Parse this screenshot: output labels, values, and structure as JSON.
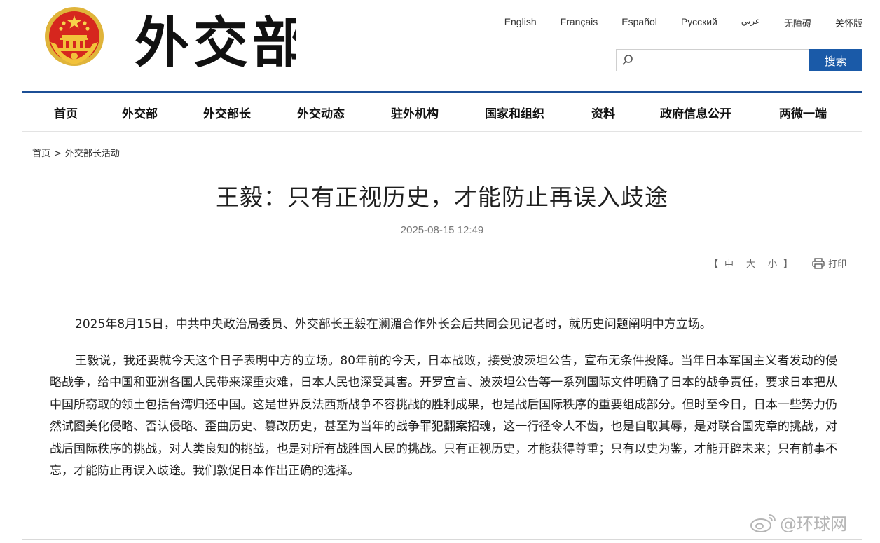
{
  "header": {
    "site_name": "外交部",
    "languages": [
      "English",
      "Français",
      "Español",
      "Русский",
      "عربي",
      "无障碍",
      "关怀版"
    ],
    "search": {
      "placeholder": "",
      "button_label": "搜索"
    }
  },
  "nav": {
    "items": [
      "首页",
      "外交部",
      "外交部长",
      "外交动态",
      "驻外机构",
      "国家和组织",
      "资料",
      "政府信息公开",
      "两微一端"
    ]
  },
  "breadcrumb": {
    "home": "首页",
    "separator": ">",
    "section": "外交部长活动"
  },
  "article": {
    "title": "王毅：只有正视历史，才能防止再误入歧途",
    "date": "2025-08-15 12:49",
    "font_size": {
      "open": "【",
      "large": "中",
      "medium": "大",
      "small": "小",
      "close": "】"
    },
    "print_label": "打印",
    "paragraphs": [
      "2025年8月15日，中共中央政治局委员、外交部长王毅在澜湄合作外长会后共同会见记者时，就历史问题阐明中方立场。",
      "王毅说，我还要就今天这个日子表明中方的立场。80年前的今天，日本战败，接受波茨坦公告，宣布无条件投降。当年日本军国主义者发动的侵略战争，给中国和亚洲各国人民带来深重灾难，日本人民也深受其害。开罗宣言、波茨坦公告等一系列国际文件明确了日本的战争责任，要求日本把从中国所窃取的领土包括台湾归还中国。这是世界反法西斯战争不容挑战的胜利成果，也是战后国际秩序的重要组成部分。但时至今日，日本一些势力仍然试图美化侵略、否认侵略、歪曲历史、篡改历史，甚至为当年的战争罪犯翻案招魂，这一行径令人不齿，也是自取其辱，是对联合国宪章的挑战，对战后国际秩序的挑战，对人类良知的挑战，也是对所有战胜国人民的挑战。只有正视历史，才能获得尊重；只有以史为鉴，才能开辟未来；只有前事不忘，才能防止再误入歧途。我们敦促日本作出正确的选择。"
    ]
  },
  "watermark": {
    "text": "@环球网"
  },
  "colors": {
    "nav_rule": "#1c4f96",
    "search_button": "#1a5aa8",
    "emblem_red": "#d6261e",
    "emblem_gold": "#f2c23a"
  },
  "icons": [
    "national-emblem",
    "search-icon",
    "printer-icon",
    "weibo-icon"
  ]
}
